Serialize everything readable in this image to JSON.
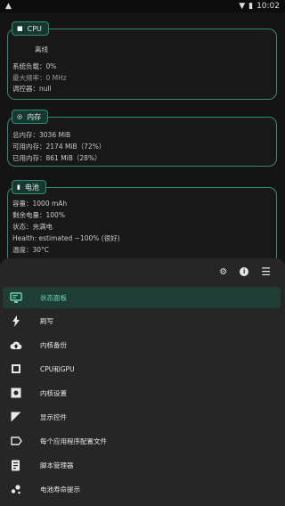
{
  "status_bar": {
    "time": "10:02"
  },
  "cpu_card": {
    "title": "CPU",
    "state": "离线",
    "load": "系统负载：0%",
    "max_freq": "最大频率：0 MHz",
    "governor": "调控器：null"
  },
  "memory_card": {
    "title": "内存",
    "total": "总内存：3036 MiB",
    "available": "可用内存：2174 MiB（72%）",
    "used": "已用内存：861 MiB（28%）"
  },
  "battery_card": {
    "title": "电池",
    "capacity": "容量：1000 mAh",
    "remaining": "剩余电量：100%",
    "status": "状态：充满电",
    "health": "Health: estimated ~100% (很好)",
    "temperature": "温度：30°C"
  },
  "menu": {
    "items": [
      {
        "label": "状态面板",
        "icon": "dashboard-icon",
        "active": true
      },
      {
        "label": "刷写",
        "icon": "flash-icon"
      },
      {
        "label": "内核备份",
        "icon": "cloud-upload-icon"
      },
      {
        "label": "CPU和GPU",
        "icon": "chip-icon"
      },
      {
        "label": "内核设置",
        "icon": "kernel-settings-icon"
      },
      {
        "label": "显示控件",
        "icon": "display-icon"
      },
      {
        "label": "每个应用程序配置文件",
        "icon": "label-icon"
      },
      {
        "label": "脚本管理器",
        "icon": "script-icon"
      },
      {
        "label": "电池寿命提示",
        "icon": "bubbles-icon"
      }
    ]
  },
  "colors": {
    "accent": "#2f8b76",
    "accent_text": "#63d5b6",
    "background": "#141414",
    "sheet": "#262626"
  }
}
